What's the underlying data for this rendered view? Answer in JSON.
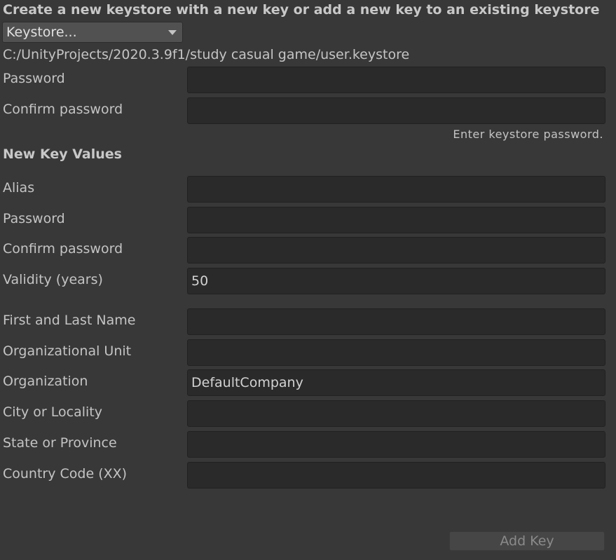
{
  "title": "Create a new keystore with a new key or add a new key to an existing keystore",
  "keystore_dropdown": {
    "value": "Keystore..."
  },
  "keystore_path": "C:/UnityProjects/2020.3.9f1/study casual game/user.keystore",
  "keystore_fields": {
    "password_label": "Password",
    "confirm_label": "Confirm password",
    "help_text": "Enter keystore password."
  },
  "new_key": {
    "heading": "New Key Values",
    "alias_label": "Alias",
    "password_label": "Password",
    "confirm_label": "Confirm password",
    "validity_label": "Validity (years)",
    "validity_value": "50",
    "name_label": "First and Last Name",
    "unit_label": "Organizational Unit",
    "org_label": "Organization",
    "org_value": "DefaultCompany",
    "city_label": "City or Locality",
    "state_label": "State or Province",
    "country_label": "Country Code (XX)"
  },
  "add_key_button": "Add Key"
}
